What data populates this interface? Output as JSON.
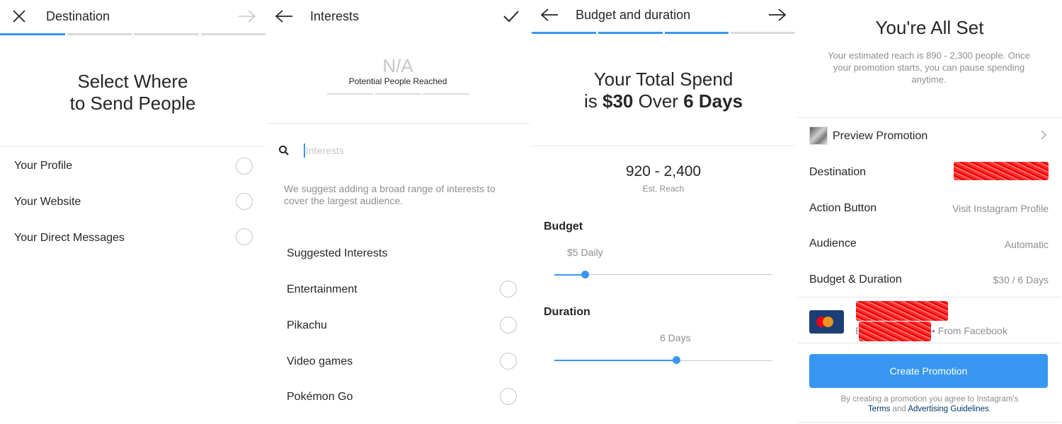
{
  "colors": {
    "accent": "#3897f0",
    "divider": "#e6e6e6",
    "muted": "#8e8e8e",
    "text": "#262626",
    "redaction": "#ff2a2a"
  },
  "destination_screen": {
    "header_title": "Destination",
    "icons": {
      "left": "close-icon",
      "right": "arrow-right-icon"
    },
    "progress_step": "1 of 4",
    "heading_line1": "Select Where",
    "heading_line2": "to Send People",
    "options": [
      {
        "label": "Your Profile"
      },
      {
        "label": "Your Website"
      },
      {
        "label": "Your Direct Messages"
      }
    ]
  },
  "interests_screen": {
    "header_title": "Interests",
    "icons": {
      "left": "arrow-left-icon",
      "right": "check-icon",
      "search": "search-icon"
    },
    "reach_value": "N/A",
    "reach_label": "Potential People Reached",
    "search_placeholder": "Interests",
    "hint": "We suggest adding a broad range of interests to cover the largest audience.",
    "section_title": "Suggested Interests",
    "interests": [
      {
        "label": "Entertainment"
      },
      {
        "label": "Pikachu"
      },
      {
        "label": "Video games"
      },
      {
        "label": "Pokémon Go"
      }
    ]
  },
  "budget_screen": {
    "header_title": "Budget and duration",
    "icons": {
      "left": "arrow-left-icon",
      "right": "arrow-right-icon"
    },
    "progress_step": "3 of 4",
    "spend_line1": "Your Total Spend",
    "spend_prefix": "is",
    "spend_amount": "$30",
    "spend_middle": "Over",
    "spend_days": "6 Days",
    "reach_value": "920 - 2,400",
    "reach_label": "Est. Reach",
    "budget_label": "Budget",
    "budget_value": "$5 Daily",
    "budget_level": 0.14,
    "duration_label": "Duration",
    "duration_value": "6 Days",
    "duration_level": 0.56
  },
  "summary_screen": {
    "title": "You're All Set",
    "subtitle": "Your estimated reach is 890 - 2,300 people. Once your promotion starts, you can pause spending anytime.",
    "preview_label": "Preview Promotion",
    "icons": {
      "preview": "post-thumbnail-icon",
      "chevron": "chevron-right-icon",
      "card": "mastercard-icon"
    },
    "rows": [
      {
        "label": "Destination",
        "value": ""
      },
      {
        "label": "Action Button",
        "value": "Visit Instagram Profile"
      },
      {
        "label": "Audience",
        "value": "Automatic"
      },
      {
        "label": "Budget & Duration",
        "value": "$30 / 6 Days"
      }
    ],
    "payment_prefix": "B",
    "payment_source": "• From Facebook",
    "create_button": "Create Promotion",
    "legal_line1": "By creating a promotion you agree to Instagram's",
    "legal_terms": "Terms",
    "legal_and": "and",
    "legal_guidelines": "Advertising Guidelines",
    "legal_end": "."
  }
}
